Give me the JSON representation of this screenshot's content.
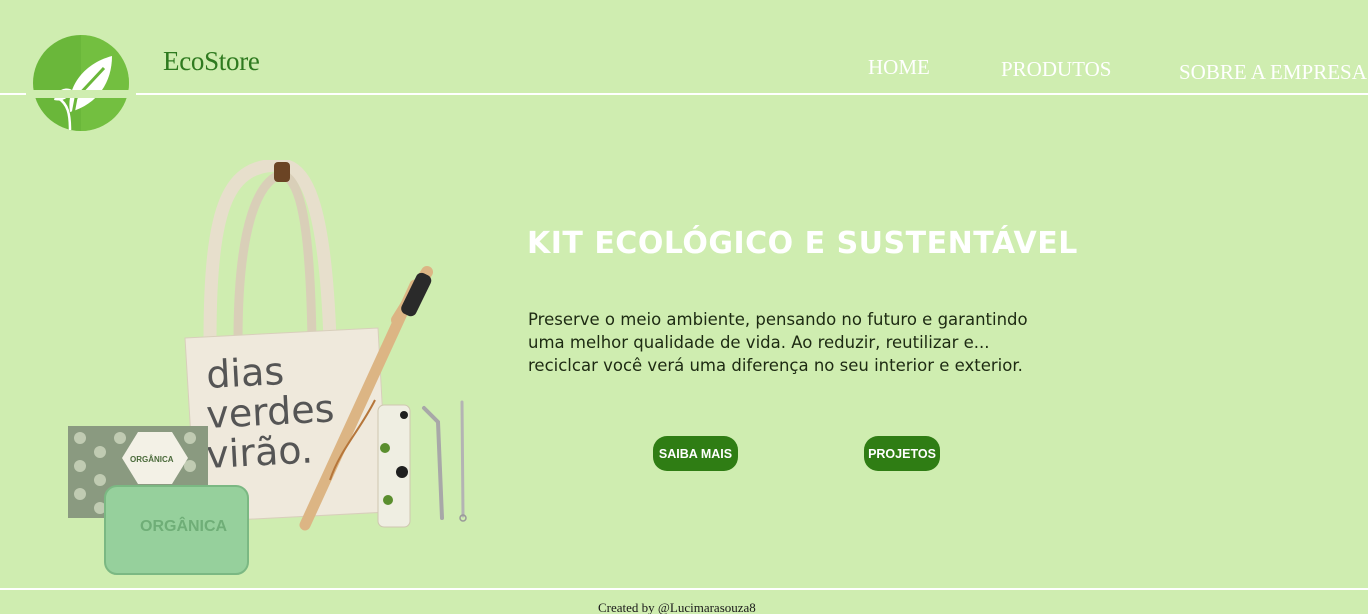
{
  "header": {
    "brand": "EcoStore",
    "nav": [
      {
        "label": "HOME"
      },
      {
        "label": "PRODUTOS"
      },
      {
        "label": "SOBRE A EMPRESA"
      }
    ]
  },
  "hero": {
    "title": "KIT ECOLÓGICO E SUSTENTÁVEL",
    "description": "Preserve o meio ambiente, pensando no futuro e garantindo uma melhor qualidade de vida. Ao reduzir, reutilizar e... reciclcar você verá uma diferença no seu interior e exterior.",
    "bag_text": [
      "dias",
      "verdes",
      "virão."
    ],
    "soap_brand": "ORGÂNICA",
    "buttons": {
      "primary": "SAIBA MAIS",
      "secondary": "PROJETOS"
    }
  },
  "footer": {
    "credit": "Created by @Lucimarasouza8"
  },
  "colors": {
    "background": "#cfedb0",
    "button": "#2f7d14",
    "brand": "#2e7a1f"
  }
}
